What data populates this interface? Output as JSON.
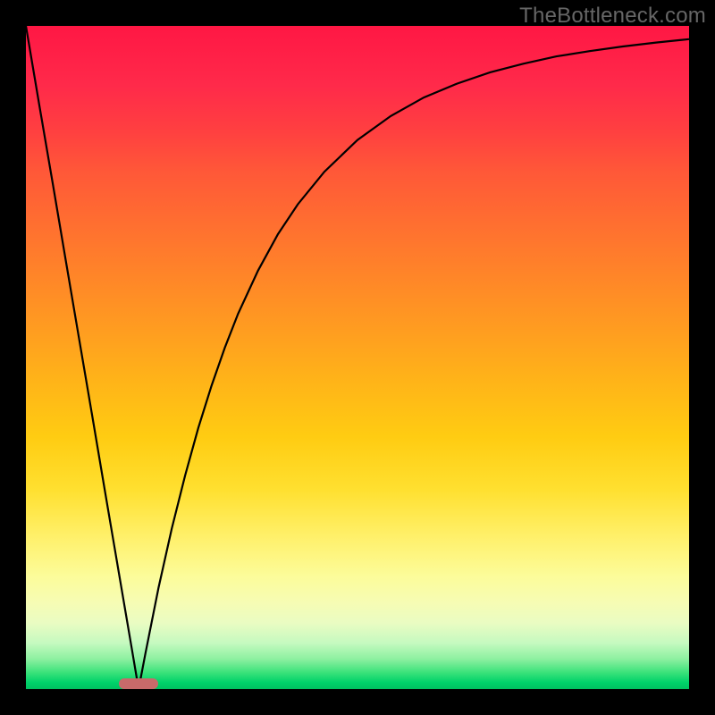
{
  "watermark": "TheBottleneck.com",
  "chart_data": {
    "type": "line",
    "title": "",
    "xlabel": "",
    "ylabel": "",
    "xlim": [
      0,
      100
    ],
    "ylim": [
      0,
      100
    ],
    "marker": {
      "x_start": 14,
      "x_end": 20,
      "y": 0,
      "color": "#c86a6a"
    },
    "x": [
      0,
      2,
      4,
      6,
      8,
      10,
      12,
      14,
      16,
      17,
      18,
      20,
      22,
      24,
      26,
      28,
      30,
      32,
      35,
      38,
      41,
      45,
      50,
      55,
      60,
      65,
      70,
      75,
      80,
      85,
      90,
      95,
      100
    ],
    "y": [
      100,
      88.2,
      76.5,
      64.7,
      52.9,
      41.2,
      29.4,
      17.6,
      5.9,
      0,
      5.3,
      15.3,
      24.2,
      32.2,
      39.4,
      45.8,
      51.5,
      56.6,
      63.1,
      68.6,
      73.1,
      78.0,
      82.8,
      86.4,
      89.2,
      91.3,
      93.0,
      94.3,
      95.4,
      96.2,
      96.9,
      97.5,
      98.0
    ],
    "grid": false,
    "legend": false
  },
  "colors": {
    "curve": "#000000",
    "marker": "#c86a6a",
    "gradient_top": "#ff1744",
    "gradient_bottom": "#00c060"
  }
}
